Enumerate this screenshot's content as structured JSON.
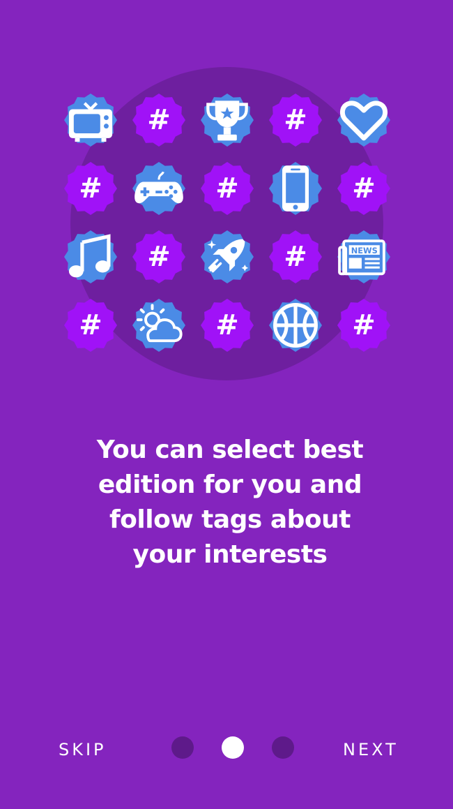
{
  "headline": "You can select best edition for you and follow tags about your interests",
  "navigation": {
    "skip_label": "SKIP",
    "next_label": "NEXT"
  },
  "pagination": {
    "total": 3,
    "current": 2
  },
  "colors": {
    "background": "#8424be",
    "halo": "#6e1f9f",
    "badge_blue": "#4b8be6",
    "badge_purple": "#a012f7",
    "dot_inactive": "#5e1a8a",
    "dot_active": "#ffffff"
  },
  "badges": [
    {
      "icon": "tv-icon",
      "variant": "blue"
    },
    {
      "icon": "hashtag-icon",
      "variant": "purple",
      "label": "#"
    },
    {
      "icon": "trophy-icon",
      "variant": "blue"
    },
    {
      "icon": "hashtag-icon",
      "variant": "purple",
      "label": "#"
    },
    {
      "icon": "heart-icon",
      "variant": "blue"
    },
    {
      "icon": "hashtag-icon",
      "variant": "purple",
      "label": "#"
    },
    {
      "icon": "gamepad-icon",
      "variant": "blue"
    },
    {
      "icon": "hashtag-icon",
      "variant": "purple",
      "label": "#"
    },
    {
      "icon": "smartphone-icon",
      "variant": "blue"
    },
    {
      "icon": "hashtag-icon",
      "variant": "purple",
      "label": "#"
    },
    {
      "icon": "music-note-icon",
      "variant": "blue"
    },
    {
      "icon": "hashtag-icon",
      "variant": "purple",
      "label": "#"
    },
    {
      "icon": "rocket-icon",
      "variant": "blue"
    },
    {
      "icon": "hashtag-icon",
      "variant": "purple",
      "label": "#"
    },
    {
      "icon": "newspaper-icon",
      "variant": "blue",
      "label": "NEWS"
    },
    {
      "icon": "hashtag-icon",
      "variant": "purple",
      "label": "#"
    },
    {
      "icon": "weather-icon",
      "variant": "blue"
    },
    {
      "icon": "hashtag-icon",
      "variant": "purple",
      "label": "#"
    },
    {
      "icon": "basketball-icon",
      "variant": "blue"
    },
    {
      "icon": "hashtag-icon",
      "variant": "purple",
      "label": "#"
    }
  ]
}
